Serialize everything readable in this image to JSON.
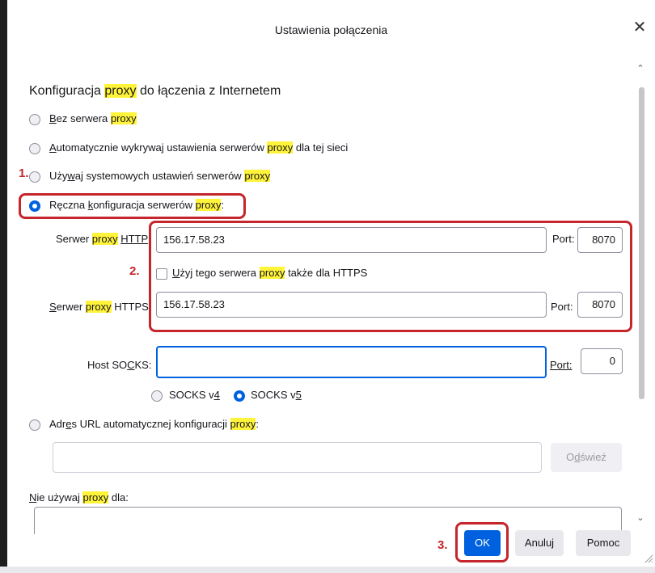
{
  "dialog": {
    "title": "Ustawienia połączenia"
  },
  "proxy": {
    "heading": [
      "Konfiguracja ",
      "proxy",
      " do łączenia z Internetem"
    ],
    "options": [
      {
        "pre": "",
        "acc": "B",
        "mid": "ez serwera ",
        "proxy": "proxy",
        "post": ""
      },
      {
        "pre": "",
        "acc": "A",
        "mid": "utomatycznie wykrywaj ustawienia serwerów ",
        "proxy": "proxy",
        "post": " dla tej sieci"
      },
      {
        "pre": "Uży",
        "acc": "w",
        "mid": "aj systemowych ustawień serwerów ",
        "proxy": "proxy",
        "post": ""
      },
      {
        "pre": "Ręczna ",
        "acc": "k",
        "mid": "onfiguracja serwerów ",
        "proxy": "proxy",
        "post": ":"
      }
    ],
    "selected_option": 3
  },
  "manual": {
    "http_label": [
      "Serwer ",
      "proxy",
      " ",
      "HTTP"
    ],
    "http_value": "156.17.58.23",
    "port_label": "Port:",
    "http_port": "8070",
    "reuse_label": [
      "U",
      "ż",
      "yj tego serwera ",
      "proxy",
      " także dla HTTPS"
    ],
    "reuse_checked": false,
    "https_label": [
      "S",
      "erwer ",
      "proxy",
      " HTTPS"
    ],
    "https_value": "156.17.58.23",
    "https_port": "8070",
    "socks_label": [
      "Host SO",
      "C",
      "KS:"
    ],
    "socks_value": "",
    "socks_port": "0",
    "socks_v4": [
      "SOCKS v",
      "4"
    ],
    "socks_v5": [
      "SOCKS v",
      "5"
    ],
    "socks_selected": "v5"
  },
  "autoconfig": {
    "label": [
      "Adr",
      "e",
      "s URL automatycznej konfiguracji ",
      "proxy",
      ":"
    ],
    "url_value": "",
    "reload_button": [
      "O",
      "d",
      "świeź"
    ]
  },
  "no_proxy": {
    "label": [
      "N",
      "ie używaj ",
      "proxy",
      " dla:"
    ],
    "value": ""
  },
  "annotations": {
    "step1": "1.",
    "step2": "2.",
    "step3": "3."
  },
  "buttons": {
    "ok": "OK",
    "cancel": "Anuluj",
    "help": "Pomoc"
  },
  "background_fragment": "e",
  "colors": {
    "accent": "#0061e0",
    "highlight": "#fff43a",
    "annotation": "#c5252b"
  }
}
